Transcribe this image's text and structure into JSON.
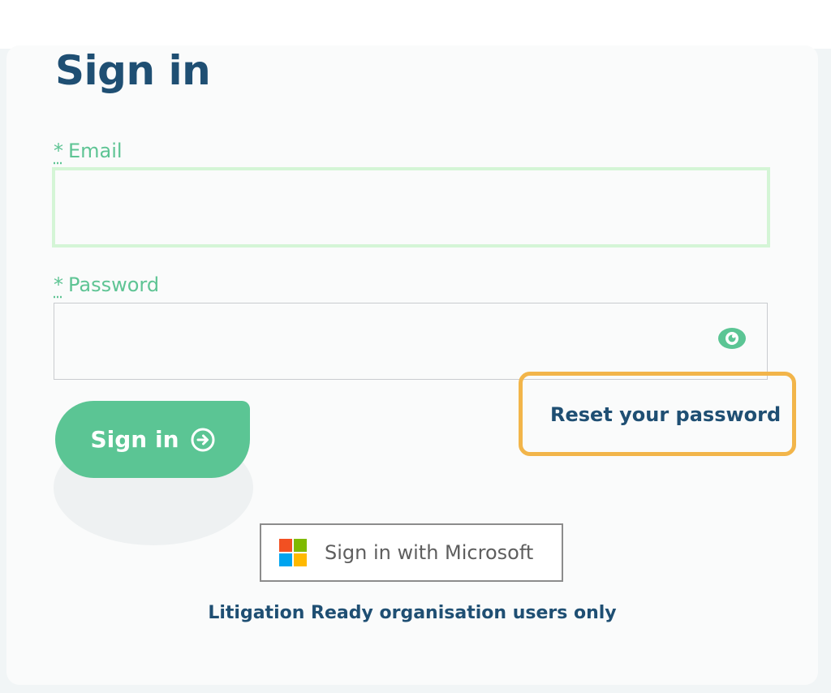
{
  "page": {
    "title": "Sign in"
  },
  "form": {
    "email": {
      "label": "Email",
      "required_mark": "*",
      "value": "",
      "placeholder": ""
    },
    "password": {
      "label": "Password",
      "required_mark": "*",
      "value": "",
      "placeholder": "",
      "toggle_icon": "eye-icon"
    },
    "submit_label": "Sign in",
    "submit_icon": "arrow-right-circle-icon",
    "reset_link": "Reset your password"
  },
  "sso": {
    "label": "Sign in with Microsoft",
    "logo_colors": [
      "#f25022",
      "#7fba00",
      "#00a4ef",
      "#ffb900"
    ]
  },
  "footnote": "Litigation Ready organisation users only",
  "colors": {
    "primary_text": "#1f4f73",
    "accent_green": "#5bc594",
    "highlight_orange": "#f2b54a"
  }
}
